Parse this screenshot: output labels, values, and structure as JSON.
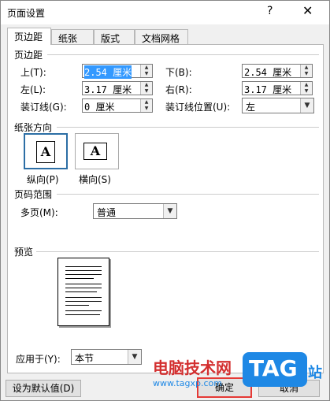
{
  "window": {
    "title": "页面设置",
    "help_glyph": "?",
    "close_glyph": "✕"
  },
  "tabs": [
    {
      "label": "页边距"
    },
    {
      "label": "纸张"
    },
    {
      "label": "版式"
    },
    {
      "label": "文档网格"
    }
  ],
  "margins": {
    "section_label": "页边距",
    "top": {
      "label": "上(T):",
      "value": "2.54 厘米"
    },
    "bottom": {
      "label": "下(B):",
      "value": "2.54 厘米"
    },
    "left": {
      "label": "左(L):",
      "value": "3.17 厘米"
    },
    "right": {
      "label": "右(R):",
      "value": "3.17 厘米"
    },
    "gutter": {
      "label": "装订线(G):",
      "value": "0 厘米"
    },
    "gutter_pos": {
      "label": "装订线位置(U):",
      "value": "左"
    }
  },
  "orientation": {
    "section_label": "纸张方向",
    "portrait_label": "纵向(P)",
    "landscape_label": "横向(S)",
    "glyph": "A"
  },
  "pages": {
    "section_label": "页码范围",
    "multi_label": "多页(M):",
    "multi_value": "普通"
  },
  "preview": {
    "section_label": "预览"
  },
  "apply": {
    "label": "应用于(Y):",
    "value": "本节"
  },
  "buttons": {
    "default": "设为默认值(D)",
    "ok": "确定",
    "cancel": "取消"
  },
  "watermark": {
    "site_cn": "电脑技术网",
    "url": "www.tagxp.com",
    "logo": "TAG",
    "zhan": "站"
  },
  "colors": {
    "accent": "#2c6ea5",
    "selection": "#3399ff",
    "ok_outline": "#e53935",
    "watermark_red": "#d32f2f",
    "watermark_blue": "#1e88e5"
  }
}
